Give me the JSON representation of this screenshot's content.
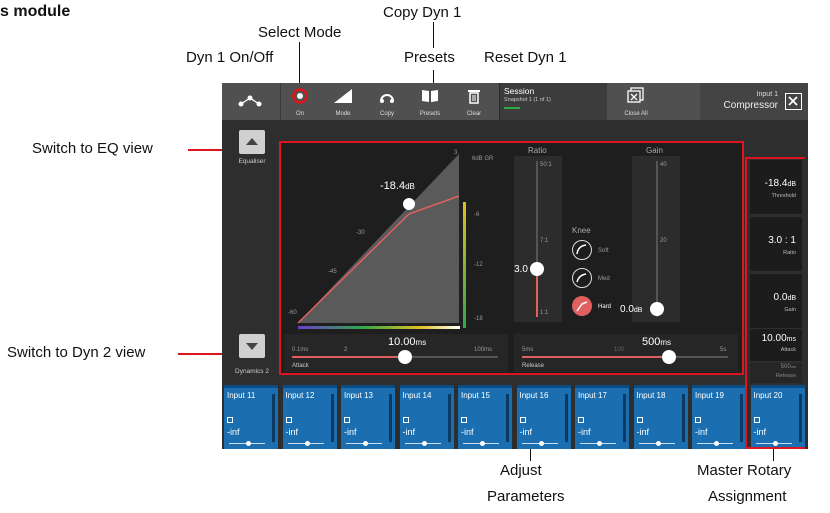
{
  "callouts": {
    "title_fragment": "s module",
    "select_mode": "Select Mode",
    "copy_dyn": "Copy Dyn 1",
    "dyn_on_off": "Dyn 1 On/Off",
    "presets": "Presets",
    "reset_dyn": "Reset Dyn 1",
    "switch_eq": "Switch to EQ view",
    "switch_dyn2": "Switch to Dyn 2 view",
    "adjust_params_1": "Adjust",
    "adjust_params_2": "Parameters",
    "master_rotary_1": "Master Rotary",
    "master_rotary_2": "Assignment"
  },
  "toolbar": {
    "on_label": "On",
    "mode_label": "Mode",
    "copy_label": "Copy",
    "presets_label": "Presets",
    "clear_label": "Clear",
    "session_title": "Session",
    "session_sub": "Snapshot 1 (1 of 1)",
    "close_all_label": "Close All",
    "input_name": "Input 1",
    "processor_name": "Compressor"
  },
  "nav": {
    "equaliser": "Equaliser",
    "dynamics2": "Dynamics 2"
  },
  "graph": {
    "threshold_display": "-18.4",
    "threshold_unit": "dB",
    "scale_top": "3",
    "gr_label": "6dB GR",
    "axis_labels": [
      "-30",
      "-45",
      "-60"
    ],
    "gr_scale": [
      "-6",
      "-12",
      "-18"
    ]
  },
  "ratio": {
    "title": "Ratio",
    "scale": [
      "50:1",
      "7:1",
      "1:1"
    ],
    "value": "3.0"
  },
  "knee": {
    "title": "Knee",
    "options": [
      "Soft",
      "Med",
      "Hard"
    ],
    "selected": "Hard"
  },
  "gain": {
    "title": "Gain",
    "scale": [
      "40",
      "20"
    ],
    "value": "0.0",
    "unit": "dB"
  },
  "attack": {
    "value": "10.00",
    "unit": "ms",
    "min": "0.1ms",
    "mid": "2",
    "max": "100ms",
    "label": "Attack"
  },
  "release": {
    "value": "500",
    "unit": "ms",
    "min": "5ms",
    "mid": "100",
    "max": "5s",
    "label": "Release"
  },
  "rotary": [
    {
      "value": "-18.4",
      "unit": "dB",
      "name": "Threshold"
    },
    {
      "value": "3.0 : 1",
      "unit": "",
      "name": "Ratio"
    },
    {
      "value": "0.0",
      "unit": "dB",
      "name": "Gain"
    },
    {
      "value": "10.00",
      "unit": "ms",
      "name": "Attack"
    },
    {
      "value": "500",
      "unit": "ms",
      "name": "Release"
    }
  ],
  "strips": [
    {
      "name": "Input 11",
      "level": "-inf"
    },
    {
      "name": "Input 12",
      "level": "-inf"
    },
    {
      "name": "Input 13",
      "level": "-inf"
    },
    {
      "name": "Input 14",
      "level": "-inf"
    },
    {
      "name": "Input 15",
      "level": "-inf"
    },
    {
      "name": "Input 16",
      "level": "-inf"
    },
    {
      "name": "Input 17",
      "level": "-inf"
    },
    {
      "name": "Input 18",
      "level": "-inf"
    },
    {
      "name": "Input 19",
      "level": "-inf"
    },
    {
      "name": "Input 20",
      "level": "-inf"
    }
  ],
  "colors": {
    "accent_red": "#e0141e",
    "strip_blue": "#1b6fb0",
    "toolbar": "#505050"
  }
}
